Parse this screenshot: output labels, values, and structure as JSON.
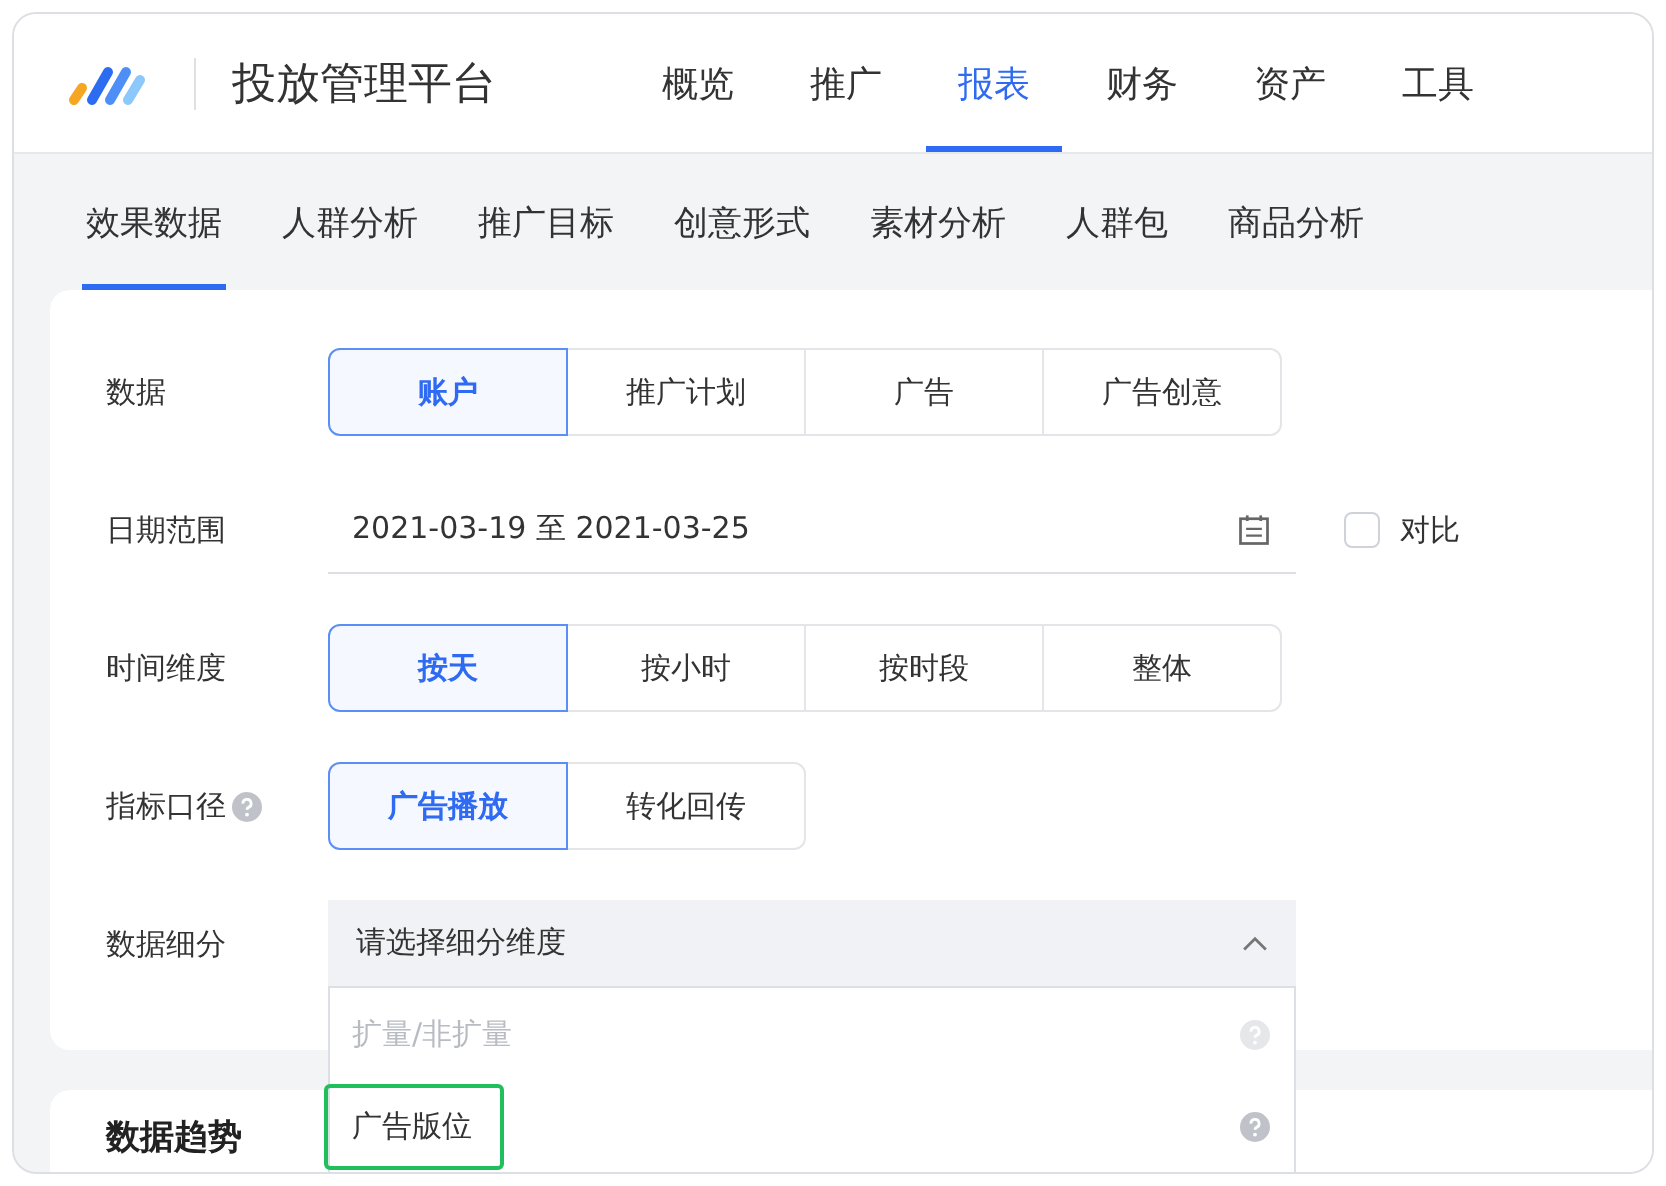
{
  "header": {
    "title": "投放管理平台",
    "nav": [
      {
        "label": "概览",
        "selected": false
      },
      {
        "label": "推广",
        "selected": false
      },
      {
        "label": "报表",
        "selected": true
      },
      {
        "label": "财务",
        "selected": false
      },
      {
        "label": "资产",
        "selected": false
      },
      {
        "label": "工具",
        "selected": false
      }
    ]
  },
  "subnav": [
    {
      "label": "效果数据",
      "selected": true
    },
    {
      "label": "人群分析",
      "selected": false
    },
    {
      "label": "推广目标",
      "selected": false
    },
    {
      "label": "创意形式",
      "selected": false
    },
    {
      "label": "素材分析",
      "selected": false
    },
    {
      "label": "人群包",
      "selected": false
    },
    {
      "label": "商品分析",
      "selected": false
    }
  ],
  "filters": [
    {
      "kind": "segmented",
      "label": "数据",
      "help": false,
      "options": [
        {
          "label": "账户",
          "selected": true
        },
        {
          "label": "推广计划",
          "selected": false
        },
        {
          "label": "广告",
          "selected": false
        },
        {
          "label": "广告创意",
          "selected": false
        }
      ]
    },
    {
      "kind": "date",
      "label": "日期范围",
      "help": false,
      "value": "2021-03-19 至 2021-03-25",
      "compare": {
        "label": "对比",
        "checked": false
      }
    },
    {
      "kind": "segmented",
      "label": "时间维度",
      "help": false,
      "options": [
        {
          "label": "按天",
          "selected": true
        },
        {
          "label": "按小时",
          "selected": false
        },
        {
          "label": "按时段",
          "selected": false
        },
        {
          "label": "整体",
          "selected": false
        }
      ]
    },
    {
      "kind": "segmented",
      "label": "指标口径",
      "help": true,
      "options": [
        {
          "label": "广告播放",
          "selected": true
        },
        {
          "label": "转化回传",
          "selected": false
        }
      ]
    },
    {
      "kind": "select",
      "label": "数据细分",
      "help": false,
      "placeholder": "请选择细分维度",
      "expanded": true,
      "options": [
        {
          "label": "扩量/非扩量",
          "disabled": true,
          "highlighted": false
        },
        {
          "label": "广告版位",
          "disabled": false,
          "highlighted": true
        }
      ]
    }
  ],
  "section": {
    "title": "数据趋势"
  }
}
